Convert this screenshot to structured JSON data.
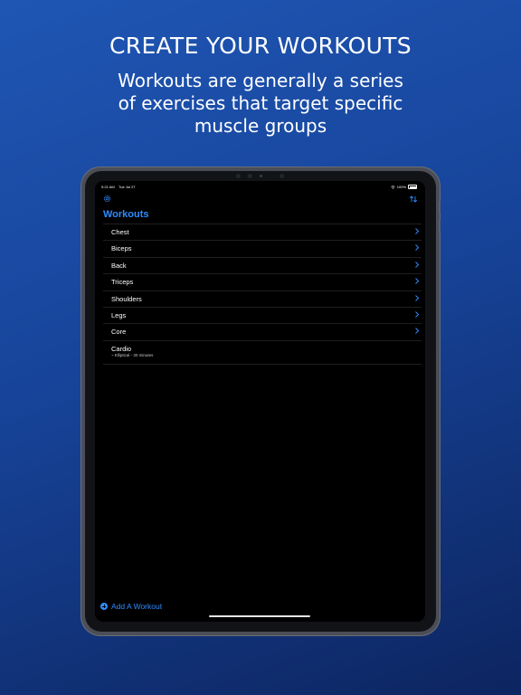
{
  "promo": {
    "headline": "CREATE YOUR WORKOUTS",
    "subline": "Workouts are generally a series of exercises that target specific muscle groups"
  },
  "status_bar": {
    "time": "9:21 AM",
    "date": "Tue Jul 27",
    "battery": "100%"
  },
  "toolbar": {
    "settings_icon": "gear-icon",
    "sort_icon": "sort-arrows-icon"
  },
  "nav": {
    "title": "Workouts"
  },
  "workouts": [
    {
      "label": "Chest"
    },
    {
      "label": "Biceps"
    },
    {
      "label": "Back"
    },
    {
      "label": "Triceps"
    },
    {
      "label": "Shoulders"
    },
    {
      "label": "Legs"
    },
    {
      "label": "Core"
    }
  ],
  "cardio": {
    "label": "Cardio",
    "detail": "~ Elliptical - 30 minutes"
  },
  "footer": {
    "add_label": "Add A Workout"
  },
  "colors": {
    "accent": "#2f8cff",
    "background_top": "#1f56b4",
    "background_bottom": "#0d2560"
  }
}
